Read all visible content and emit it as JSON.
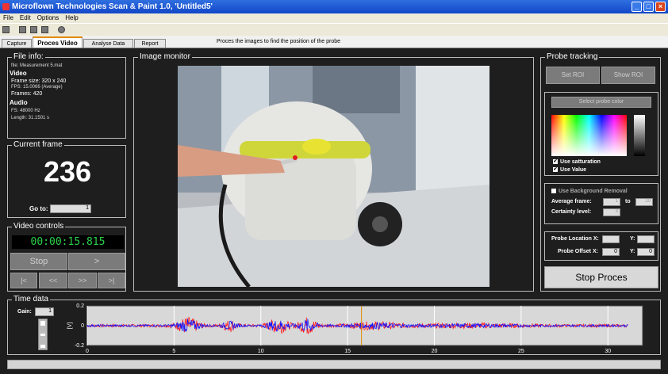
{
  "window": {
    "title": "Microflown Technologies Scan & Paint 1.0, 'Untitled5'"
  },
  "menu": [
    "File",
    "Edit",
    "Options",
    "Help"
  ],
  "tabs": [
    {
      "label": "Capture",
      "active": false
    },
    {
      "label": "Proces Video",
      "active": true
    },
    {
      "label": "Analyse Data",
      "active": false
    },
    {
      "label": "Report",
      "active": false
    }
  ],
  "tab_description": "Proces the images to find the position of the probe",
  "file_info": {
    "label": "File info:",
    "file": "file: Measurement 5.mat",
    "video_header": "Video",
    "frame_size": "Frame size: 320 x 240",
    "fps": "FPS: 15.0066 (Average)",
    "frames": "Frames: 420",
    "audio_header": "Audio",
    "fs": "FS: 48000 Hz",
    "length": "Length: 31.1501 s"
  },
  "current_frame": {
    "label": "Current frame",
    "value": "236",
    "goto_label": "Go to:",
    "goto_value": "1"
  },
  "video_controls": {
    "label": "Video controls",
    "timecode": "00:00:15.815",
    "stop": "Stop",
    "play": ">",
    "first": "|<",
    "rewind": "<<",
    "forward": ">>",
    "last": ">|"
  },
  "image_monitor": {
    "label": "Image monitor"
  },
  "probe_tracking": {
    "label": "Probe tracking",
    "set_roi": "Set ROI",
    "show_roi": "Show ROI",
    "select_probe_color": "Select probe color",
    "use_saturation": "Use satturation",
    "use_value": "Use Value",
    "use_background_removal": "Use Background Removal",
    "average_frame": "Average frame:",
    "avg_from": "1",
    "to": "to",
    "avg_to": "10",
    "certainty_level": "Certainty level:",
    "certainty_value": "3",
    "probe_location_x": "Probe Location X:",
    "probe_location_y": "Y:",
    "probe_offset_x": "Probe Offset X:",
    "probe_offset_x_value": "0",
    "probe_offset_y": "Y:",
    "probe_offset_y_value": "0",
    "stop_proces": "Stop Proces"
  },
  "time_data": {
    "label": "Time data",
    "gain_label": "Gain:",
    "gain_value": "1"
  },
  "chart_data": {
    "type": "line",
    "ylabel": "[V]",
    "xlim": [
      0,
      32
    ],
    "ylim": [
      -0.2,
      0.2
    ],
    "xticks": [
      "0",
      "5",
      "10",
      "15",
      "20",
      "25",
      "30"
    ],
    "yticks": [
      "0.2",
      "0",
      "-0.2"
    ],
    "marker_x": 15.8,
    "series_colors": {
      "red": "#ff2020",
      "blue": "#1414ff"
    }
  },
  "colors": {
    "accent_tab": "#e08a00",
    "titlebar": "#1a56d6",
    "timecode": "#2ad24a"
  }
}
